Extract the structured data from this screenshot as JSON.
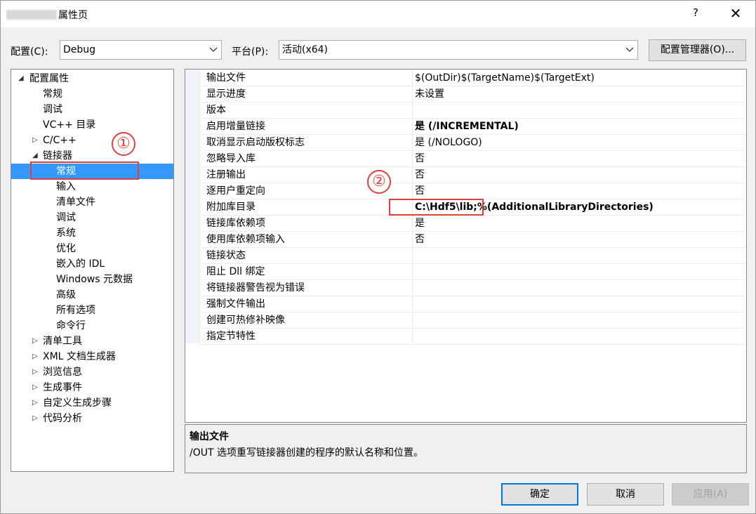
{
  "window": {
    "title": "属性页",
    "help_label": "?",
    "close_label": "✕"
  },
  "config_bar": {
    "config_label": "配置(C):",
    "config_value": "Debug",
    "platform_label": "平台(P):",
    "platform_value": "活动(x64)",
    "manager_button": "配置管理器(O)..."
  },
  "tree": {
    "items": [
      {
        "label": "配置属性",
        "expander": "◢",
        "level": 0
      },
      {
        "label": "常规",
        "expander": "",
        "level": 1
      },
      {
        "label": "调试",
        "expander": "",
        "level": 1
      },
      {
        "label": "VC++ 目录",
        "expander": "",
        "level": 1
      },
      {
        "label": "C/C++",
        "expander": "▷",
        "level": 1
      },
      {
        "label": "链接器",
        "expander": "◢",
        "level": 1
      },
      {
        "label": "常规",
        "expander": "",
        "level": 2,
        "selected": true
      },
      {
        "label": "输入",
        "expander": "",
        "level": 2
      },
      {
        "label": "清单文件",
        "expander": "",
        "level": 2
      },
      {
        "label": "调试",
        "expander": "",
        "level": 2
      },
      {
        "label": "系统",
        "expander": "",
        "level": 2
      },
      {
        "label": "优化",
        "expander": "",
        "level": 2
      },
      {
        "label": "嵌入的 IDL",
        "expander": "",
        "level": 2
      },
      {
        "label": "Windows 元数据",
        "expander": "",
        "level": 2
      },
      {
        "label": "高级",
        "expander": "",
        "level": 2
      },
      {
        "label": "所有选项",
        "expander": "",
        "level": 2
      },
      {
        "label": "命令行",
        "expander": "",
        "level": 2
      },
      {
        "label": "清单工具",
        "expander": "▷",
        "level": 1
      },
      {
        "label": "XML 文档生成器",
        "expander": "▷",
        "level": 1
      },
      {
        "label": "浏览信息",
        "expander": "▷",
        "level": 1
      },
      {
        "label": "生成事件",
        "expander": "▷",
        "level": 1
      },
      {
        "label": "自定义生成步骤",
        "expander": "▷",
        "level": 1
      },
      {
        "label": "代码分析",
        "expander": "▷",
        "level": 1
      }
    ]
  },
  "properties": {
    "rows": [
      {
        "name": "输出文件",
        "value": "$(OutDir)$(TargetName)$(TargetExt)",
        "bold": false
      },
      {
        "name": "显示进度",
        "value": "未设置",
        "bold": false
      },
      {
        "name": "版本",
        "value": "",
        "bold": false
      },
      {
        "name": "启用增量链接",
        "value": "是 (/INCREMENTAL)",
        "bold": true
      },
      {
        "name": "取消显示启动版权标志",
        "value": "是 (/NOLOGO)",
        "bold": false
      },
      {
        "name": "忽略导入库",
        "value": "否",
        "bold": false
      },
      {
        "name": "注册输出",
        "value": "否",
        "bold": false
      },
      {
        "name": "逐用户重定向",
        "value": "否",
        "bold": false
      },
      {
        "name": "附加库目录",
        "value": "C:\\Hdf5\\lib;%(AdditionalLibraryDirectories)",
        "bold": true
      },
      {
        "name": "链接库依赖项",
        "value": "是",
        "bold": false
      },
      {
        "name": "使用库依赖项输入",
        "value": "否",
        "bold": false
      },
      {
        "name": "链接状态",
        "value": "",
        "bold": false
      },
      {
        "name": "阻止 Dll 绑定",
        "value": "",
        "bold": false
      },
      {
        "name": "将链接器警告视为错误",
        "value": "",
        "bold": false
      },
      {
        "name": "强制文件输出",
        "value": "",
        "bold": false
      },
      {
        "name": "创建可热修补映像",
        "value": "",
        "bold": false
      },
      {
        "name": "指定节特性",
        "value": "",
        "bold": false
      }
    ]
  },
  "description": {
    "title": "输出文件",
    "text": "/OUT 选项重写链接器创建的程序的默认名称和位置。"
  },
  "annotations": {
    "marker_1": "①",
    "marker_2": "②",
    "color": "#e0403a"
  },
  "footer": {
    "ok": "确定",
    "cancel": "取消",
    "apply": "应用(A)"
  },
  "colors": {
    "selection": "#3399ff",
    "primary_border": "#0078d7"
  }
}
